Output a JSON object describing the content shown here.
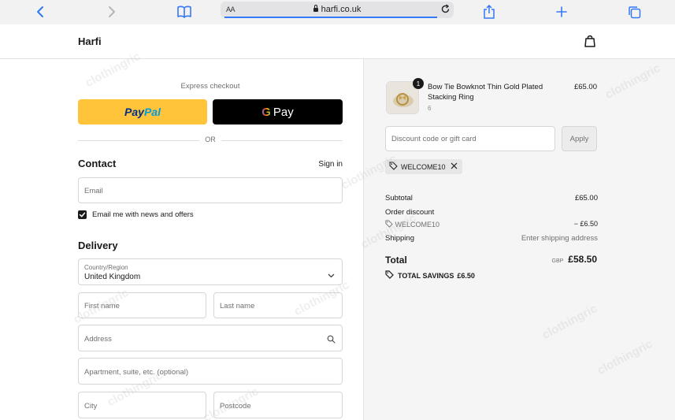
{
  "browser": {
    "text_size_label": "AA",
    "url": "harfi.co.uk"
  },
  "store": {
    "brand": "Harfi"
  },
  "checkout": {
    "express_label": "Express checkout",
    "paypal": {
      "part1": "Pay",
      "part2": "Pal"
    },
    "gpay": {
      "g": "G",
      "label": "Pay"
    },
    "or_label": "OR",
    "contact": {
      "heading": "Contact",
      "signin": "Sign in",
      "email_placeholder": "Email",
      "newsletter_label": "Email me with news and offers",
      "newsletter_checked": true
    },
    "delivery": {
      "heading": "Delivery",
      "country_label": "Country/Region",
      "country_value": "United Kingdom",
      "first_name_placeholder": "First name",
      "last_name_placeholder": "Last name",
      "address_placeholder": "Address",
      "apartment_placeholder": "Apartment, suite, etc. (optional)",
      "city_placeholder": "City",
      "postcode_placeholder": "Postcode"
    }
  },
  "summary": {
    "item": {
      "quantity": "1",
      "name": "Bow Tie Bowknot Thin Gold Plated Stacking Ring",
      "variant": "6",
      "price": "£65.00"
    },
    "discount_placeholder": "Discount code or gift card",
    "apply_label": "Apply",
    "applied_code": "WELCOME10",
    "subtotal_label": "Subtotal",
    "subtotal_value": "£65.00",
    "order_discount_label": "Order discount",
    "discount_code": "WELCOME10",
    "discount_value": "− £6.50",
    "shipping_label": "Shipping",
    "shipping_value": "Enter shipping address",
    "total_label": "Total",
    "currency": "GBP",
    "total_value": "£58.50",
    "savings_label": "TOTAL SAVINGS",
    "savings_value": "£6.50"
  },
  "watermark": "clothingric"
}
